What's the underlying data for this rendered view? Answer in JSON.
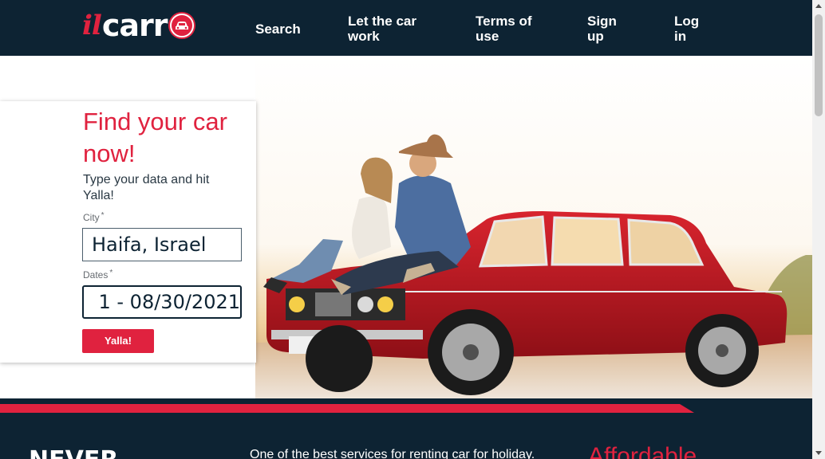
{
  "colors": {
    "header_bg": "#0d2333",
    "accent_red": "#e0223f",
    "white": "#ffffff"
  },
  "header": {
    "logo": {
      "il": "il",
      "carr": "carr",
      "icon": "car-in-circle-icon"
    },
    "nav": {
      "search": "Search",
      "let_car_work": "Let the car work",
      "terms": "Terms of use",
      "signup": "Sign up",
      "login": "Log in"
    }
  },
  "hero": {
    "photo": "couple-sitting-on-red-car-photo"
  },
  "search_card": {
    "title": "Find your car now!",
    "subtitle": "Type your data and hit Yalla!",
    "city_label": "City",
    "city_required": "*",
    "city_value": "Haifa, Israel",
    "dates_label": "Dates",
    "dates_required": "*",
    "dates_value": "1 - 08/30/2021",
    "submit_label": "Yalla!"
  },
  "lower_band": {
    "heading": "NEVER",
    "text": "One of the best services for renting car for holiday.",
    "right_heading": "Affordable"
  }
}
